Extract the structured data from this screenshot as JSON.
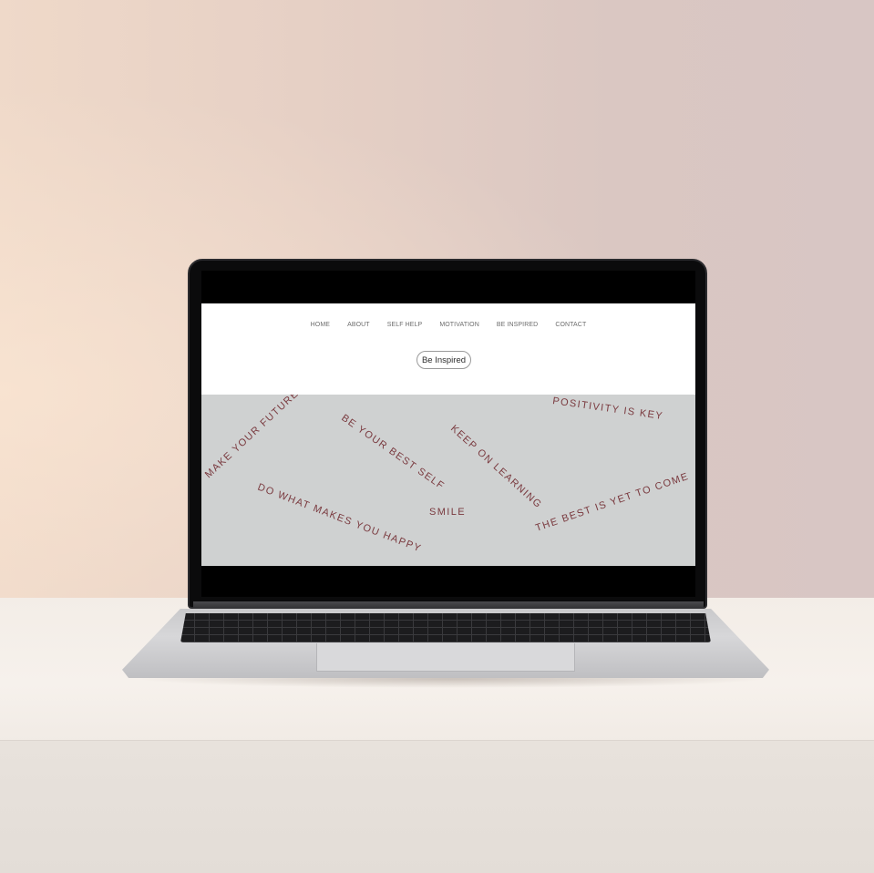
{
  "nav": {
    "items": [
      "HOME",
      "ABOUT",
      "SELF HELP",
      "MOTIVATION",
      "BE INSPIRED",
      "CONTACT"
    ]
  },
  "cta": {
    "label": "Be Inspired"
  },
  "quotes": [
    "MAKE YOUR FUTURE",
    "BE YOUR BEST SELF",
    "KEEP ON LEARNING",
    "POSITIVITY IS KEY",
    "DO WHAT MAKES YOU HAPPY",
    "SMILE",
    "THE BEST IS YET TO COME"
  ],
  "colors": {
    "quote_text": "#7a3a3f",
    "quote_band": "#cfd1d1",
    "nav_text": "#6d6d6d",
    "screen_frame": "#000000"
  }
}
